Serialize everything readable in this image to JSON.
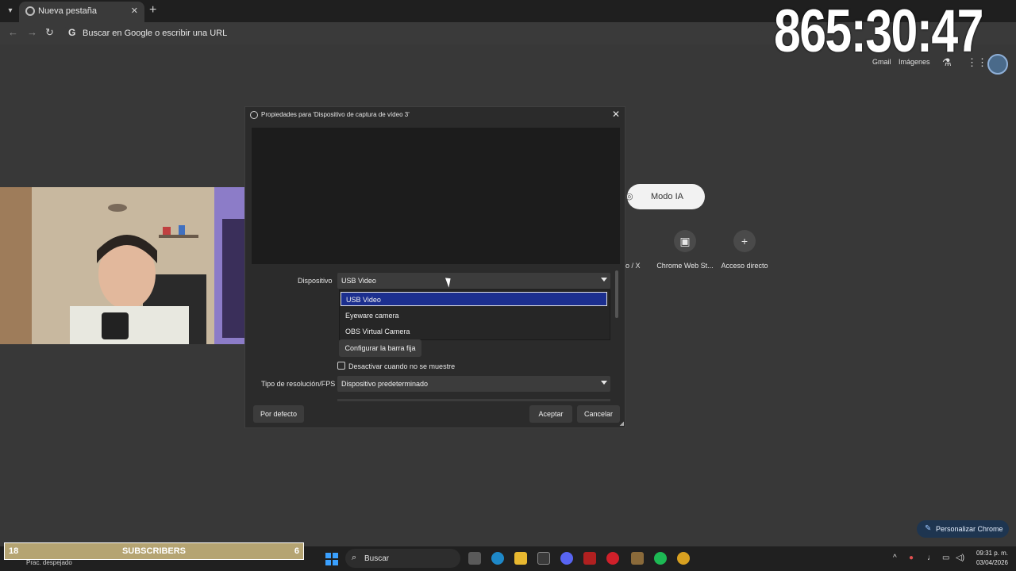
{
  "browser": {
    "tab_title": "Nueva pestaña",
    "omnibox_placeholder": "Buscar en Google o escribir una URL",
    "top_links": [
      "Gmail",
      "Imágenes"
    ]
  },
  "clock": "865:30:47",
  "newtab": {
    "ai_mode": "Modo IA",
    "x_label": "o / X",
    "shortcuts": [
      "Chrome Web St...",
      "Acceso directo"
    ]
  },
  "dialog": {
    "title": "Propiedades para 'Dispositivo de captura de vídeo 3'",
    "device_label": "Dispositivo",
    "device_value": "USB Video",
    "device_options": [
      "USB Video",
      "Eyeware camera",
      "OBS Virtual Camera"
    ],
    "config_button": "Configurar la barra fija",
    "deactivate_checkbox": "Desactivar cuando no se muestre",
    "resolution_label": "Tipo de resolución/FPS",
    "resolution_value": "Dispositivo predeterminado",
    "defaults_button": "Por defecto",
    "accept_button": "Aceptar",
    "cancel_button": "Cancelar"
  },
  "personalize": "Personalizar Chrome",
  "subscribers": {
    "left": "18",
    "label": "SUBSCRIBERS",
    "right": "6"
  },
  "taskbar": {
    "weather": "Prac. despejado",
    "search": "Buscar",
    "time": "09:31 p. m.",
    "date": "03/04/2026"
  },
  "colors": {
    "selection": "#1c2f8f",
    "subscribers_bar": "#b5a472"
  }
}
